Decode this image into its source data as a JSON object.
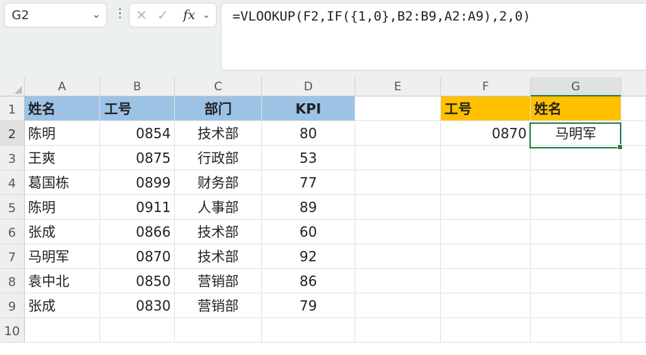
{
  "namebox": {
    "value": "G2"
  },
  "formula_bar": {
    "text": "=VLOOKUP(F2,IF({1,0},B2:B9,A2:A9),2,0)",
    "fx_label": "fx"
  },
  "columns": [
    "A",
    "B",
    "C",
    "D",
    "E",
    "F",
    "G"
  ],
  "rows": [
    "1",
    "2",
    "3",
    "4",
    "5",
    "6",
    "7",
    "8",
    "9",
    "10"
  ],
  "table": {
    "headers": [
      "姓名",
      "工号",
      "部门",
      "KPI"
    ],
    "rows": [
      [
        "陈明",
        "0854",
        "技术部",
        "80"
      ],
      [
        "王爽",
        "0875",
        "行政部",
        "53"
      ],
      [
        "葛国栋",
        "0899",
        "财务部",
        "77"
      ],
      [
        "陈明",
        "0911",
        "人事部",
        "89"
      ],
      [
        "张成",
        "0866",
        "技术部",
        "60"
      ],
      [
        "马明军",
        "0870",
        "技术部",
        "92"
      ],
      [
        "袁中北",
        "0850",
        "营销部",
        "86"
      ],
      [
        "张成",
        "0830",
        "营销部",
        "79"
      ]
    ]
  },
  "lookup": {
    "headers": [
      "工号",
      "姓名"
    ],
    "id": "0870",
    "result": "马明军"
  },
  "colors": {
    "header_blue": "#9cc3e6",
    "header_gold": "#ffc000",
    "selection": "#1f7a44"
  }
}
